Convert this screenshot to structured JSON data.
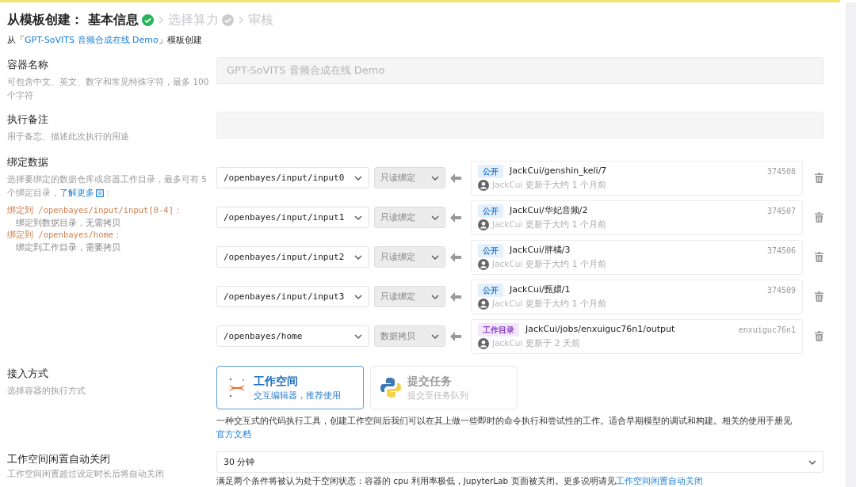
{
  "header": {
    "prefix": "从模板创建：",
    "steps": [
      {
        "label": "基本信息",
        "selected": true,
        "kind": "check"
      },
      {
        "label": "选择算力",
        "selected": false,
        "kind": "check"
      },
      {
        "label": "审核",
        "selected": false
      }
    ],
    "source": {
      "before": "从「",
      "link": "GPT-SoVITS 音频合成在线 Demo",
      "after": "」模板创建"
    }
  },
  "container_name": {
    "label": "容器名称",
    "hint": "可包含中文、英文、数字和常见特殊字符，最多 100 个字符",
    "placeholder": "GPT-SoVITS 音频合成在线 Demo"
  },
  "note": {
    "label": "执行备注",
    "hint": "用于备忘、描述此次执行的用途"
  },
  "bindings": {
    "label": "绑定数据",
    "hint": "选择要绑定的数据仓库或容器工作目录，最多可有 5 个绑定目录，",
    "link": "了解更多",
    "after": "：",
    "rules": [
      {
        "title": "绑定到 /openbayes/input/input[0-4]：",
        "desc": "绑定到数据目录，无需拷贝"
      },
      {
        "title": "绑定到 /openbayes/home：",
        "desc": "绑定到工作目录，需要拷贝"
      }
    ],
    "rows": [
      {
        "path": "/openbayes/input/input0",
        "mode": "只读绑定",
        "tag": "公开",
        "kind": "public",
        "name": "JackCui/genshin_keli/7",
        "id": "374508",
        "owner": "JackCui",
        "updated": "更新于大约 1 个月前"
      },
      {
        "path": "/openbayes/input/input1",
        "mode": "只读绑定",
        "tag": "公开",
        "kind": "public",
        "name": "JackCui/华妃音频/2",
        "id": "374507",
        "owner": "JackCui",
        "updated": "更新于大约 1 个月前"
      },
      {
        "path": "/openbayes/input/input2",
        "mode": "只读绑定",
        "tag": "公开",
        "kind": "public",
        "name": "JackCui/胖橘/3",
        "id": "374506",
        "owner": "JackCui",
        "updated": "更新于大约 1 个月前"
      },
      {
        "path": "/openbayes/input/input3",
        "mode": "只读绑定",
        "tag": "公开",
        "kind": "public",
        "name": "JackCui/甄嬛/1",
        "id": "374509",
        "owner": "JackCui",
        "updated": "更新于大约 1 个月前"
      },
      {
        "path": "/openbayes/home",
        "mode": "数据拷贝",
        "tag": "工作目录",
        "kind": "workdir",
        "name": "JackCui/jobs/enxuiguc76n1/output",
        "id": "enxuiguc76n1",
        "owner": "JackCui",
        "updated": "更新于 2 天前"
      }
    ]
  },
  "access": {
    "label": "接入方式",
    "hint": "选择容器的执行方式",
    "options": [
      {
        "title": "工作空间",
        "desc": "交互编辑器，推荐使用",
        "kind": "jupyter",
        "selected": true
      },
      {
        "title": "提交任务",
        "desc": "提交至任务队列",
        "kind": "python",
        "selected": false
      }
    ],
    "description": "一种交互式的代码执行工具，创建工作空间后我们可以在其上做一些即时的命令执行和尝试性的工作。适合早期模型的调试和构建。相关的使用手册见",
    "link": "官方文档"
  },
  "idle": {
    "label": "工作空间闲置自动关闭",
    "hint": "工作空间闲置超过设定时长后将自动关闭",
    "value": "30 分钟",
    "note": "满足两个条件将被认为处于空闲状态：容器的 cpu 利用率极低，JupyterLab 页面被关闭。更多说明请见",
    "link": "工作空间闲置自动关闭"
  }
}
